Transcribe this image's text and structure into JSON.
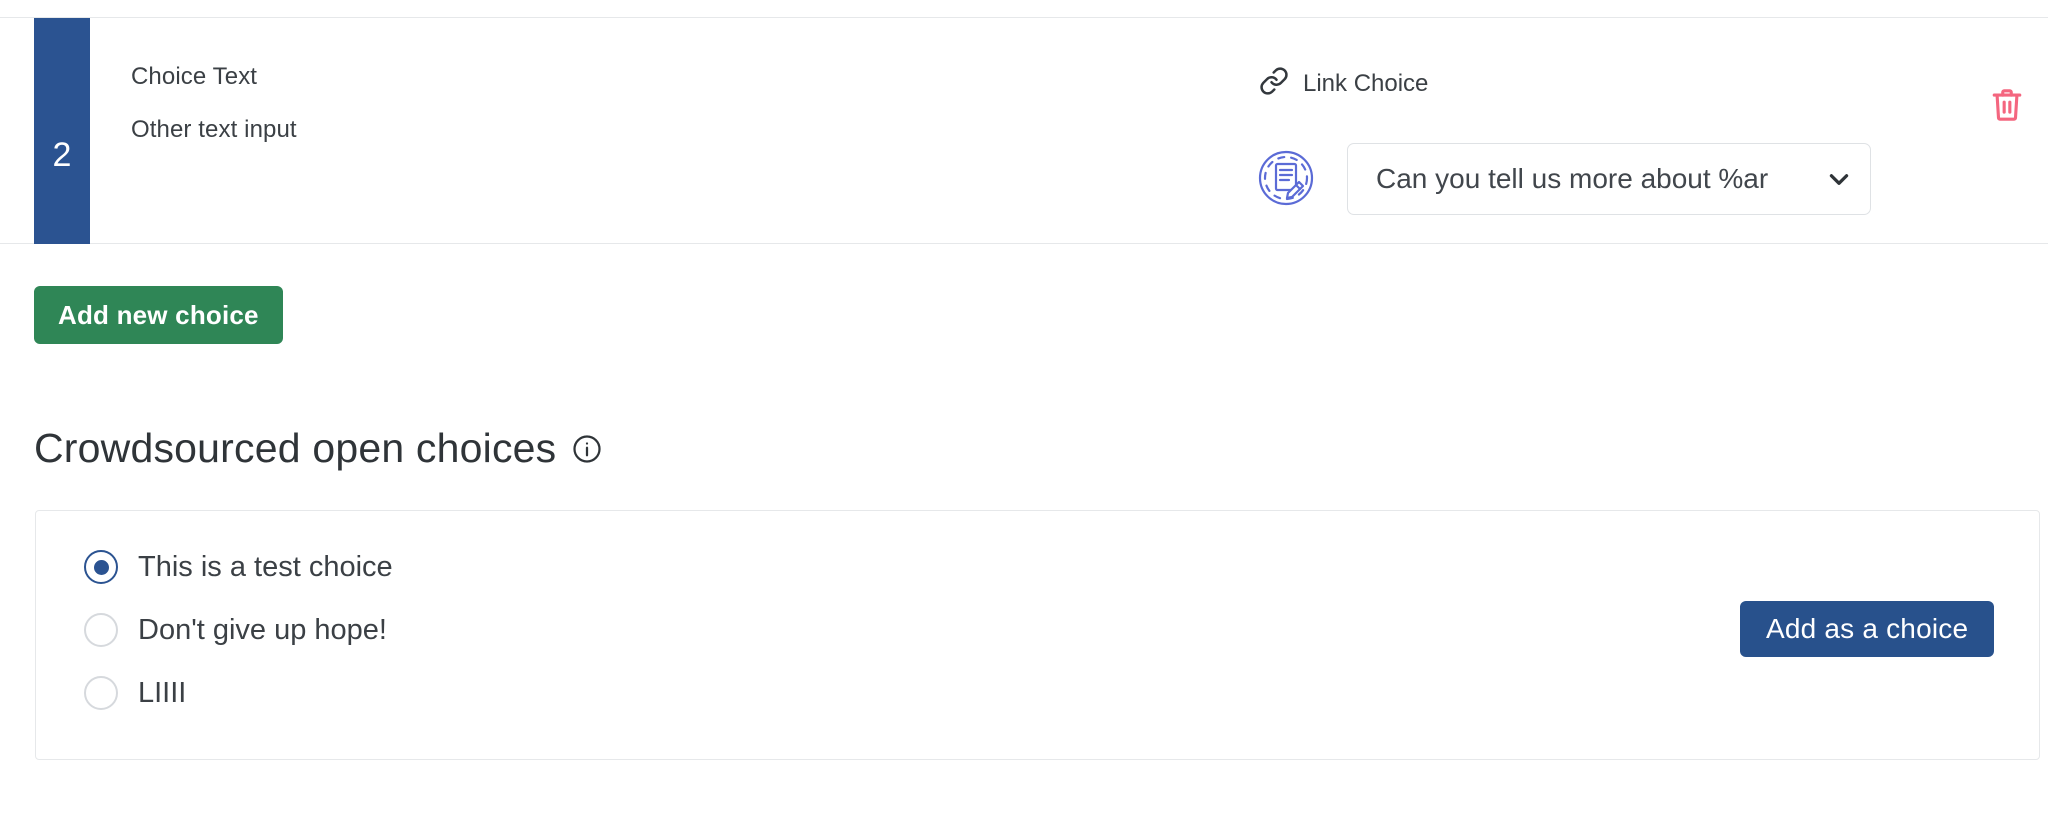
{
  "colors": {
    "index_bar_blue": "#2b5391",
    "add_new_choice_green": "#2f8656",
    "add_as_choice_blue": "#28518c",
    "delete_icon_red": "#f4667f",
    "doc_edit_icon_blue": "#5b6bd6",
    "border_gray": "#e6e8ea",
    "text_dark": "#3b4045"
  },
  "choice_row": {
    "index": "2",
    "choice_text_label": "Choice Text",
    "other_text_input_label": "Other text input",
    "link_choice_label": "Link Choice",
    "link_icon": "link-icon",
    "doc_edit_icon": "document-edit-icon",
    "delete_icon": "trash-icon",
    "followup_select": {
      "value": "Can you tell us more about %ar",
      "chevron_icon": "chevron-down-icon",
      "options": [
        "Can you tell us more about %ar"
      ]
    }
  },
  "add_new_choice_button": {
    "label": "Add new choice"
  },
  "crowdsourced": {
    "heading": "Crowdsourced open choices",
    "info_icon": "info-icon",
    "open_choices": [
      {
        "label": "This is a test choice",
        "selected": true
      },
      {
        "label": "Don't give up hope!",
        "selected": false
      },
      {
        "label": "LIIII",
        "selected": false
      }
    ],
    "add_as_choice_button": {
      "label": "Add as a choice"
    }
  }
}
